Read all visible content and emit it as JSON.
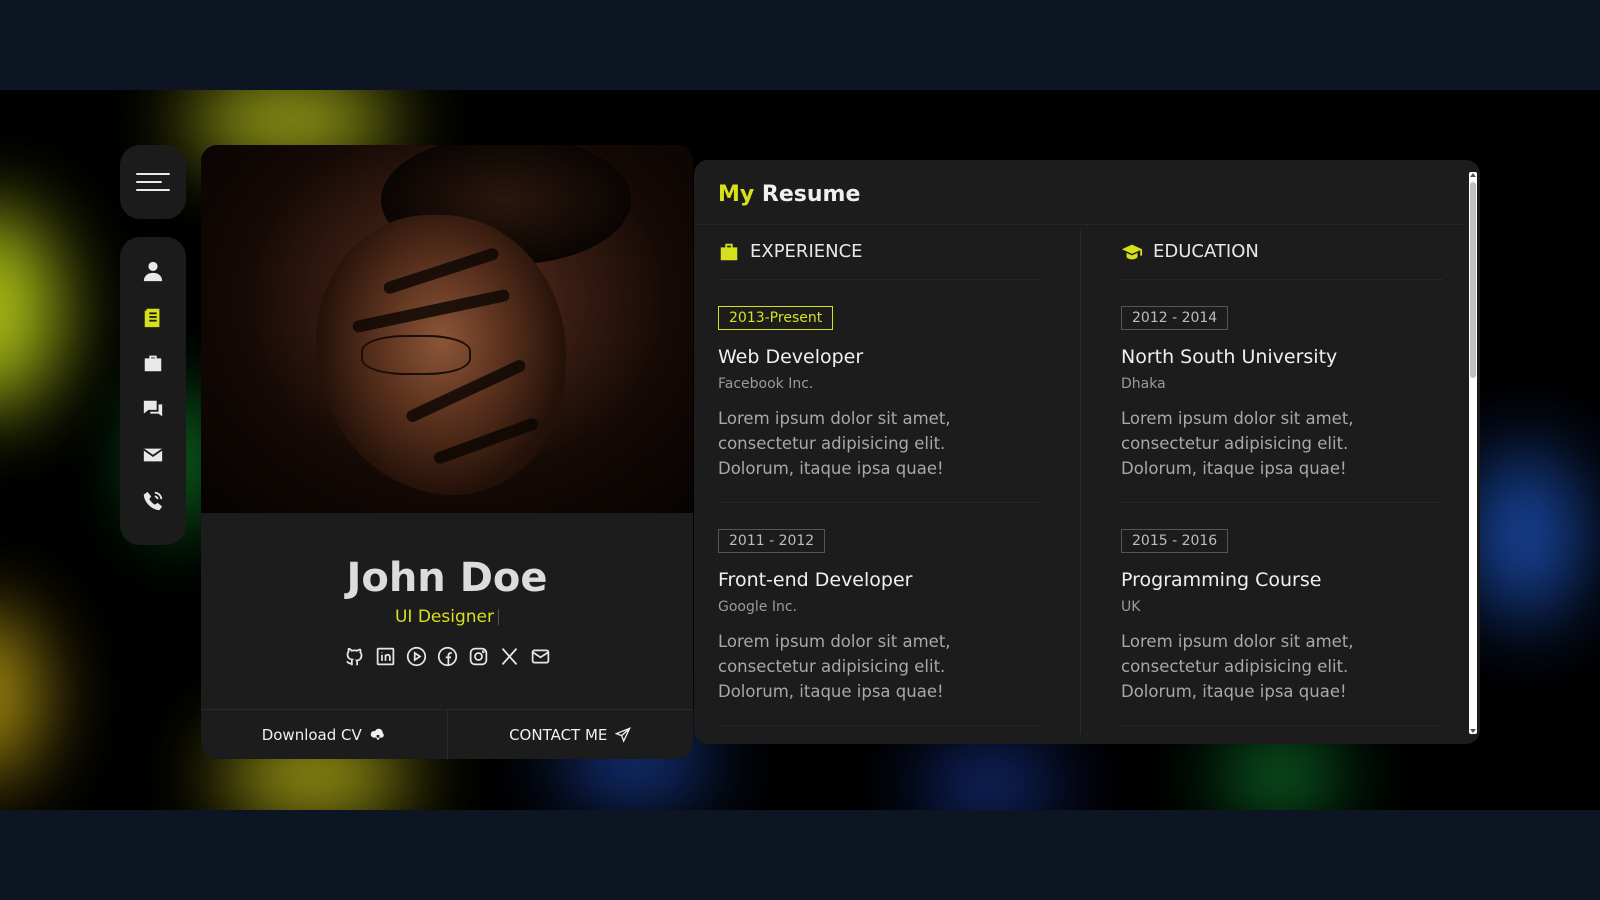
{
  "colors": {
    "accent": "#d7e01c",
    "card_bg": "#1c1c1c",
    "page_bg": "#0d1522"
  },
  "sidebar": {
    "menu_icon": "hamburger-icon",
    "items": [
      {
        "icon": "user-icon",
        "active": false
      },
      {
        "icon": "resume-icon",
        "active": true
      },
      {
        "icon": "briefcase-icon",
        "active": false
      },
      {
        "icon": "chat-icon",
        "active": false
      },
      {
        "icon": "envelope-icon",
        "active": false
      },
      {
        "icon": "phone-icon",
        "active": false
      }
    ]
  },
  "profile": {
    "name": "John Doe",
    "role": "UI Designer",
    "socials": [
      "github-icon",
      "linkedin-icon",
      "dribbble-icon",
      "facebook-icon",
      "instagram-icon",
      "x-icon",
      "mail-icon"
    ],
    "download_label": "Download CV",
    "contact_label": "CONTACT ME"
  },
  "resume": {
    "title_accent": "My",
    "title_rest": "Resume",
    "experience": {
      "heading": "EXPERIENCE",
      "items": [
        {
          "period": "2013-Present",
          "title": "Web Developer",
          "org": "Facebook Inc.",
          "desc": "Lorem ipsum dolor sit amet, consectetur adipisicing elit. Dolorum, itaque ipsa quae!"
        },
        {
          "period": "2011 - 2012",
          "title": "Front-end Developer",
          "org": "Google Inc.",
          "desc": "Lorem ipsum dolor sit amet, consectetur adipisicing elit. Dolorum, itaque ipsa quae!"
        }
      ]
    },
    "education": {
      "heading": "EDUCATION",
      "items": [
        {
          "period": "2012 - 2014",
          "title": "North South University",
          "org": "Dhaka",
          "desc": "Lorem ipsum dolor sit amet, consectetur adipisicing elit. Dolorum, itaque ipsa quae!"
        },
        {
          "period": "2015 - 2016",
          "title": "Programming Course",
          "org": "UK",
          "desc": "Lorem ipsum dolor sit amet, consectetur adipisicing elit. Dolorum, itaque ipsa quae!"
        }
      ]
    }
  }
}
